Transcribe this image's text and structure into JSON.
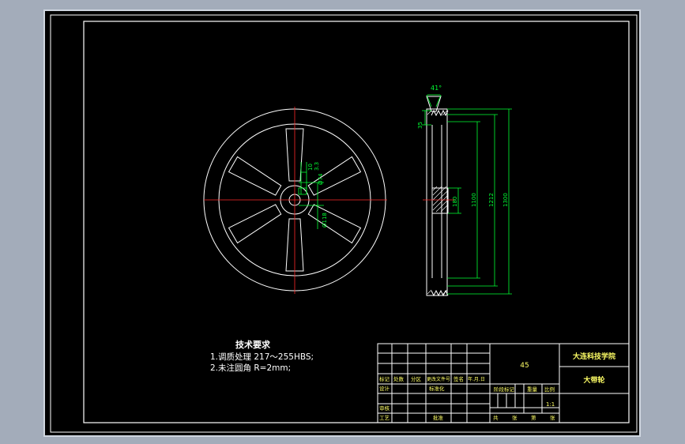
{
  "colors": {
    "frame": "#a3acba",
    "paper": "#000000",
    "line": "#ffffff",
    "center_line": "#ff2a2a",
    "dimension": "#00ff33",
    "title_block_text": "#ffff66"
  },
  "front_view": {
    "keyway_labels": [
      "10",
      "3.3"
    ],
    "bore_label": "Ø74",
    "hub_label": "Ø118"
  },
  "side_view": {
    "groove_angle": "41°",
    "rim_width": "35",
    "diameters": [
      "180",
      "1100",
      "1212",
      "1300"
    ]
  },
  "tech_req": {
    "title": "技术要求",
    "line1": "1.调质处理 217～255HBS;",
    "line2": "2.未注圆角 R=2mm;"
  },
  "title_block": {
    "material": "45",
    "school": "大连科技学院",
    "part_name": "大带轮",
    "scale": "1:1",
    "row_headers": [
      "标记",
      "处数",
      "分区",
      "更改文件号",
      "签名",
      "年.月.日"
    ],
    "designer": "设计",
    "standardize": "标准化",
    "review": "审核",
    "process": "工艺",
    "approve": "批准",
    "stage_mark": "阶段标记",
    "weight": "重量",
    "ratio": "比例",
    "total": "共",
    "sheet_total": "张",
    "sheet_no": "第",
    "sheet_unit": "张"
  }
}
